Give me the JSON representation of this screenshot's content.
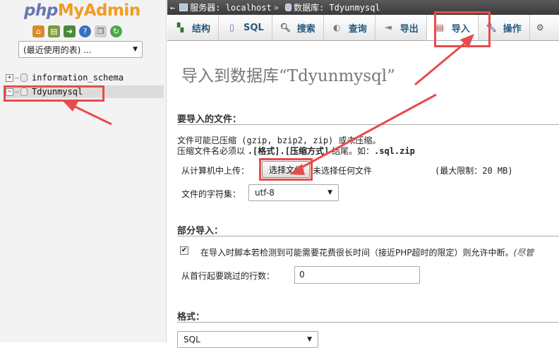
{
  "logo": {
    "php": "php",
    "my": "My",
    "admin": "Admin"
  },
  "left_panel": {
    "recent_select": "(最近使用的表) ...",
    "databases": [
      "information_schema",
      "Tdyunmysql"
    ]
  },
  "breadcrumb": {
    "back": "←",
    "server_label": "服务器: localhost",
    "separator": "»",
    "database_label": "数据库: Tdyunmysql"
  },
  "tabs": [
    {
      "label": "结构",
      "icon": "structure-icon"
    },
    {
      "label": "SQL",
      "icon": "sql-icon"
    },
    {
      "label": "搜索",
      "icon": "search-icon"
    },
    {
      "label": "查询",
      "icon": "query-icon"
    },
    {
      "label": "导出",
      "icon": "export-icon"
    },
    {
      "label": "导入",
      "icon": "import-icon"
    },
    {
      "label": "操作",
      "icon": "wrench-icon"
    }
  ],
  "main": {
    "title": "导入到数据库“Tdyunmysql”",
    "file_section": {
      "heading": "要导入的文件：",
      "compress_note": "文件可能已压缩 (gzip, bzip2, zip) 或未压缩。",
      "ext_note_prefix": "压缩文件名必须以 ",
      "ext_note_format": ".[格式].[压缩方式]",
      "ext_note_middle": " 结尾。如：",
      "ext_note_example": ".sql.zip",
      "upload_label": "从计算机中上传：",
      "choose_file_button": "选择文件",
      "no_file_text": "未选择任何文件",
      "max_limit": "(最大限制：20 MB)",
      "charset_label": "文件的字符集：",
      "charset_value": "utf-8"
    },
    "partial_section": {
      "heading": "部分导入：",
      "checkbox_label": "在导入时脚本若检测到可能需要花费很长时间（接近PHP超时的限定）则允许中断。",
      "checkbox_tail": "(尽管",
      "skip_label": "从首行起要跳过的行数：",
      "skip_value": "0"
    },
    "format_section": {
      "heading": "格式：",
      "format_value": "SQL"
    }
  },
  "colors": {
    "annotation_red": "#e74c4c",
    "link_blue": "#235a81"
  }
}
